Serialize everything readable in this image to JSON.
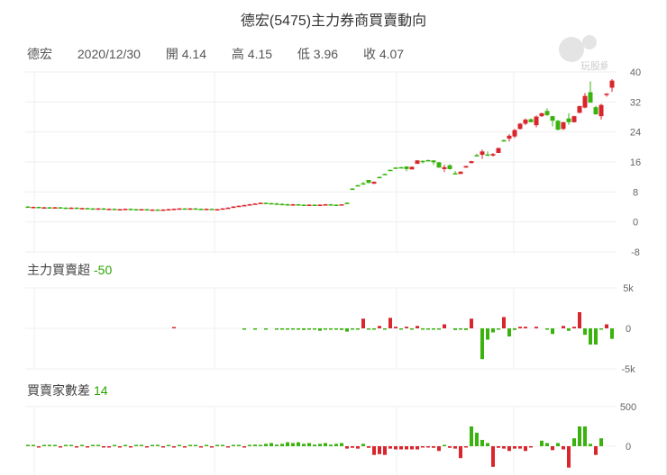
{
  "title": "德宏(5475)主力券商買賣動向",
  "info": {
    "name": "德宏",
    "date": "2020/12/30",
    "open": "開 4.14",
    "high": "高 4.15",
    "low": "低 3.96",
    "close": "收 4.07"
  },
  "watermark": "玩股網",
  "colors": {
    "up": "#d9262c",
    "down": "#3bb30f",
    "grid": "#efefef"
  },
  "panel2": {
    "label": "主力買賣超",
    "value": "-50"
  },
  "panel3": {
    "label": "買賣家數差",
    "value": "14"
  },
  "chart_data": [
    {
      "type": "candlestick",
      "name": "price",
      "yticks": [
        40,
        32,
        24,
        16,
        8,
        0,
        -8
      ],
      "ylim": [
        -8,
        40
      ],
      "candles_ohlc": [
        [
          4.1,
          4.2,
          4.0,
          4.0
        ],
        [
          4.0,
          4.1,
          3.9,
          4.0
        ],
        [
          4.0,
          4.1,
          3.9,
          3.9
        ],
        [
          3.9,
          4.0,
          3.8,
          3.9
        ],
        [
          3.9,
          4.0,
          3.8,
          3.8
        ],
        [
          3.8,
          4.0,
          3.8,
          3.9
        ],
        [
          3.9,
          4.0,
          3.8,
          3.8
        ],
        [
          3.8,
          3.9,
          3.6,
          3.7
        ],
        [
          3.7,
          3.9,
          3.6,
          3.8
        ],
        [
          3.8,
          3.9,
          3.6,
          3.6
        ],
        [
          3.6,
          3.8,
          3.6,
          3.7
        ],
        [
          3.7,
          3.8,
          3.6,
          3.6
        ],
        [
          3.6,
          3.7,
          3.5,
          3.5
        ],
        [
          3.5,
          3.7,
          3.5,
          3.6
        ],
        [
          3.6,
          3.7,
          3.2,
          3.3
        ],
        [
          3.3,
          3.6,
          3.2,
          3.5
        ],
        [
          3.5,
          3.6,
          3.3,
          3.4
        ],
        [
          3.4,
          3.5,
          3.3,
          3.4
        ],
        [
          3.4,
          3.6,
          3.3,
          3.5
        ],
        [
          3.5,
          3.6,
          3.3,
          3.4
        ],
        [
          3.4,
          3.5,
          3.2,
          3.3
        ],
        [
          3.3,
          3.5,
          3.2,
          3.4
        ],
        [
          3.4,
          3.5,
          3.1,
          3.2
        ],
        [
          3.2,
          3.4,
          3.1,
          3.3
        ],
        [
          3.3,
          3.4,
          3.1,
          3.2
        ],
        [
          3.2,
          3.4,
          3.1,
          3.3
        ],
        [
          3.3,
          3.5,
          3.2,
          3.4
        ],
        [
          3.4,
          3.6,
          3.3,
          3.5
        ],
        [
          3.5,
          3.7,
          3.4,
          3.6
        ],
        [
          3.6,
          3.7,
          3.4,
          3.5
        ],
        [
          3.5,
          3.7,
          3.4,
          3.6
        ],
        [
          3.6,
          3.7,
          3.4,
          3.5
        ],
        [
          3.5,
          3.6,
          3.3,
          3.4
        ],
        [
          3.4,
          3.6,
          3.3,
          3.5
        ],
        [
          3.5,
          3.6,
          3.2,
          3.3
        ],
        [
          3.3,
          3.5,
          3.2,
          3.4
        ],
        [
          3.4,
          3.7,
          3.3,
          3.6
        ],
        [
          3.6,
          3.9,
          3.5,
          3.8
        ],
        [
          3.8,
          4.2,
          3.7,
          4.1
        ],
        [
          4.1,
          4.4,
          4.0,
          4.3
        ],
        [
          4.3,
          4.6,
          4.2,
          4.5
        ],
        [
          4.5,
          4.8,
          4.4,
          4.7
        ],
        [
          4.7,
          5.0,
          4.6,
          4.9
        ],
        [
          4.9,
          5.2,
          4.8,
          5.1
        ],
        [
          5.1,
          5.2,
          4.9,
          5.0
        ],
        [
          5.0,
          5.1,
          4.8,
          4.9
        ],
        [
          4.9,
          5.1,
          4.7,
          4.8
        ],
        [
          4.8,
          5.0,
          4.6,
          4.7
        ],
        [
          4.7,
          4.9,
          4.4,
          4.5
        ],
        [
          4.5,
          4.8,
          4.4,
          4.7
        ],
        [
          4.7,
          4.8,
          4.5,
          4.6
        ],
        [
          4.6,
          4.7,
          4.4,
          4.5
        ],
        [
          4.5,
          4.7,
          4.4,
          4.6
        ],
        [
          4.6,
          4.7,
          4.4,
          4.5
        ],
        [
          4.5,
          4.7,
          4.4,
          4.6
        ],
        [
          4.6,
          4.8,
          4.5,
          4.7
        ],
        [
          4.7,
          4.8,
          4.5,
          4.6
        ],
        [
          4.6,
          4.7,
          4.4,
          4.5
        ],
        [
          4.5,
          4.7,
          4.4,
          4.7
        ],
        [
          5.1,
          5.2,
          5.0,
          5.0
        ],
        [
          8.9,
          9.0,
          8.8,
          8.8
        ],
        [
          9.8,
          9.9,
          9.6,
          9.7
        ],
        [
          10.3,
          10.7,
          10.0,
          10.2
        ],
        [
          11.2,
          11.2,
          10.3,
          10.4
        ],
        [
          10.2,
          10.8,
          10.1,
          10.7
        ],
        [
          12.0,
          12.1,
          11.9,
          11.9
        ],
        [
          12.8,
          12.9,
          12.7,
          12.7
        ],
        [
          13.9,
          14.0,
          13.8,
          13.8
        ],
        [
          14.5,
          14.6,
          14.3,
          14.3
        ],
        [
          14.6,
          14.7,
          14.4,
          14.5
        ],
        [
          14.8,
          14.8,
          13.5,
          14.1
        ],
        [
          14.0,
          14.8,
          14.0,
          14.7
        ],
        [
          15.5,
          16.5,
          15.5,
          16.4
        ],
        [
          16.3,
          16.4,
          15.6,
          16.1
        ],
        [
          16.5,
          16.6,
          16.3,
          16.4
        ],
        [
          16.4,
          16.5,
          15.2,
          15.9
        ],
        [
          15.9,
          16.0,
          14.4,
          14.5
        ],
        [
          14.1,
          15.3,
          13.3,
          14.6
        ],
        [
          15.1,
          15.4,
          13.9,
          14.1
        ],
        [
          13.0,
          13.6,
          12.6,
          12.8
        ],
        [
          12.8,
          13.5,
          12.8,
          13.4
        ],
        [
          14.5,
          15.0,
          14.4,
          14.9
        ],
        [
          15.7,
          16.3,
          15.6,
          16.2
        ],
        [
          17.8,
          18.2,
          17.6,
          17.7
        ],
        [
          17.9,
          19.3,
          16.8,
          18.8
        ],
        [
          18.0,
          18.8,
          17.6,
          17.8
        ],
        [
          17.7,
          18.4,
          17.4,
          18.1
        ],
        [
          18.4,
          19.8,
          18.4,
          19.7
        ],
        [
          21.8,
          22.0,
          21.6,
          21.7
        ],
        [
          22.2,
          23.4,
          21.4,
          23.0
        ],
        [
          22.8,
          24.8,
          22.4,
          24.5
        ],
        [
          24.8,
          26.4,
          24.6,
          26.2
        ],
        [
          26.2,
          27.6,
          25.8,
          27.3
        ],
        [
          27.4,
          27.6,
          26.6,
          26.6
        ],
        [
          25.8,
          28.4,
          25.2,
          28.1
        ],
        [
          28.2,
          29.1,
          28.0,
          29.0
        ],
        [
          29.6,
          30.3,
          28.2,
          28.5
        ],
        [
          28.2,
          28.3,
          25.5,
          27.0
        ],
        [
          27.0,
          27.2,
          24.4,
          24.6
        ],
        [
          24.8,
          26.7,
          24.5,
          26.6
        ],
        [
          27.6,
          29.0,
          25.9,
          26.6
        ],
        [
          26.6,
          28.3,
          26.5,
          28.2
        ],
        [
          29.1,
          31.0,
          29.0,
          30.9
        ],
        [
          30.5,
          34.4,
          30.3,
          33.6
        ],
        [
          34.6,
          37.5,
          31.9,
          31.8
        ],
        [
          30.6,
          31.0,
          28.6,
          28.7
        ],
        [
          28.2,
          31.5,
          27.3,
          31.2
        ],
        [
          34.1,
          34.4,
          33.4,
          34.2
        ],
        [
          35.8,
          38.1,
          34.7,
          37.7
        ]
      ]
    },
    {
      "type": "bar",
      "name": "net-buy",
      "yticks": [
        "5k",
        "0",
        "-5k"
      ],
      "ylim": [
        -5000,
        5000
      ],
      "values": [
        0,
        0,
        0,
        0,
        0,
        0,
        0,
        0,
        0,
        0,
        0,
        0,
        0,
        0,
        0,
        0,
        0,
        0,
        0,
        0,
        0,
        0,
        0,
        0,
        0,
        0,
        0,
        100,
        0,
        0,
        0,
        0,
        0,
        0,
        0,
        0,
        0,
        0,
        0,
        0,
        -100,
        0,
        -150,
        0,
        -100,
        0,
        -150,
        -100,
        -100,
        -100,
        -150,
        -200,
        -150,
        -100,
        -300,
        -100,
        -100,
        -150,
        -200,
        -400,
        -100,
        -100,
        1200,
        -100,
        -100,
        300,
        -100,
        1300,
        200,
        -100,
        200,
        -100,
        300,
        -100,
        -100,
        -100,
        -100,
        500,
        0,
        -200,
        -100,
        -200,
        1200,
        0,
        -3800,
        -1400,
        -500,
        -100,
        1400,
        -1000,
        -200,
        200,
        200,
        0,
        200,
        0,
        -100,
        -700,
        0,
        300,
        -300,
        200,
        2000,
        -800,
        -2000,
        -2000,
        -100,
        500,
        -1300
      ]
    },
    {
      "type": "bar",
      "name": "buyer-seller-count-diff",
      "yticks": [
        "500",
        "0"
      ],
      "ylim": [
        -400,
        500
      ],
      "values": [
        10,
        5,
        -10,
        10,
        15,
        5,
        -15,
        10,
        5,
        -5,
        10,
        -10,
        15,
        5,
        -10,
        -5,
        10,
        -10,
        5,
        -15,
        10,
        5,
        -10,
        15,
        5,
        -10,
        10,
        -5,
        15,
        -10,
        5,
        10,
        -15,
        10,
        -10,
        5,
        15,
        -10,
        10,
        5,
        -10,
        15,
        20,
        10,
        30,
        40,
        20,
        30,
        50,
        40,
        50,
        30,
        40,
        20,
        30,
        40,
        20,
        30,
        40,
        -30,
        -20,
        -30,
        30,
        -20,
        -110,
        -100,
        -110,
        -30,
        -40,
        -40,
        -40,
        -40,
        -40,
        -10,
        -10,
        -20,
        -60,
        10,
        -20,
        -30,
        -150,
        -10,
        250,
        170,
        80,
        40,
        -260,
        -20,
        -30,
        -60,
        -30,
        -30,
        -60,
        -10,
        0,
        70,
        40,
        -50,
        40,
        -40,
        -270,
        100,
        250,
        250,
        30,
        -110,
        100
      ]
    }
  ]
}
